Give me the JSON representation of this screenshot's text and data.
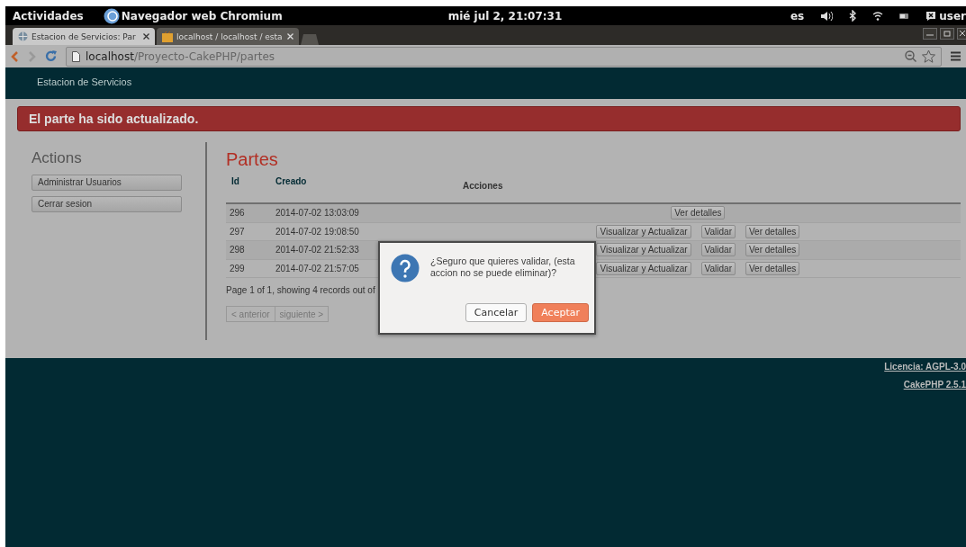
{
  "top_bar": {
    "activities": "Actividades",
    "app_name": "Navegador web Chromium",
    "clock": "mié jul 2, 21:07:31",
    "keyboard_layout": "es",
    "user": "user"
  },
  "browser": {
    "tabs": [
      {
        "title": "Estacion de Servicios: Par",
        "selected": true
      },
      {
        "title": "localhost / localhost / esta",
        "selected": false
      }
    ],
    "address": {
      "host": "localhost",
      "path": "/Proyecto-CakePHP/partes"
    }
  },
  "site": {
    "brand": "Estacion de Servicios",
    "flash": "El parte ha sido actualizado.",
    "sidebar": {
      "title": "Actions",
      "items": [
        "Administrar Usuarios",
        "Cerrar sesion"
      ]
    },
    "title": "Partes",
    "table": {
      "columns": [
        "Id",
        "Creado",
        "Acciones"
      ],
      "rows": [
        {
          "id": "296",
          "created": "2014-07-02 13:03:09",
          "actions": [
            "Ver detalles"
          ]
        },
        {
          "id": "297",
          "created": "2014-07-02 19:08:50",
          "actions": [
            "Visualizar y Actualizar",
            "Validar",
            "Ver detalles"
          ]
        },
        {
          "id": "298",
          "created": "2014-07-02 21:52:33",
          "actions": [
            "Visualizar y Actualizar",
            "Validar",
            "Ver detalles"
          ]
        },
        {
          "id": "299",
          "created": "2014-07-02 21:57:05",
          "actions": [
            "Visualizar y Actualizar",
            "Validar",
            "Ver detalles"
          ]
        }
      ]
    },
    "paging_text": "Page 1 of 1, showing 4 records out of",
    "pager": [
      {
        "label": "< anterior",
        "disabled": true
      },
      {
        "label": "siguiente >",
        "disabled": true
      }
    ],
    "footer_links": [
      "Licencia: AGPL-3.0",
      "CakePHP 2.5.1"
    ]
  },
  "dialog": {
    "message": "¿Seguro que quieres validar, (esta accion no se puede eliminar)?",
    "buttons": [
      {
        "label": "Cancelar",
        "kind": "secondary"
      },
      {
        "label": "Aceptar",
        "kind": "primary"
      }
    ]
  }
}
